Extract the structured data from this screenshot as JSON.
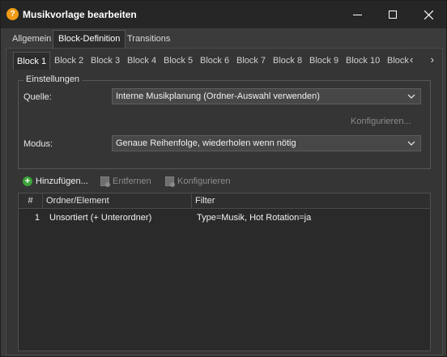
{
  "window": {
    "title": "Musikvorlage bearbeiten",
    "app_icon_glyph": "?",
    "accent_color": "#f29b16"
  },
  "main_tabs": [
    {
      "label": "Allgemein",
      "active": false
    },
    {
      "label": "Block-Definition",
      "active": true
    },
    {
      "label": "Transitions",
      "active": false
    }
  ],
  "block_tabs": [
    {
      "label": "Block 1",
      "active": true
    },
    {
      "label": "Block 2",
      "active": false
    },
    {
      "label": "Block 3",
      "active": false
    },
    {
      "label": "Block 4",
      "active": false
    },
    {
      "label": "Block 5",
      "active": false
    },
    {
      "label": "Block 6",
      "active": false
    },
    {
      "label": "Block 7",
      "active": false
    },
    {
      "label": "Block 8",
      "active": false
    },
    {
      "label": "Block 9",
      "active": false
    },
    {
      "label": "Block 10",
      "active": false
    },
    {
      "label": "Block",
      "active": false
    }
  ],
  "settings": {
    "legend": "Einstellungen",
    "source_label": "Quelle:",
    "source_value": "Interne Musikplanung (Ordner-Auswahl verwenden)",
    "configure_label": "Konfigurieren...",
    "mode_label": "Modus:",
    "mode_value": "Genaue Reihenfolge, wiederholen wenn nötig"
  },
  "toolbar": {
    "add_label": "Hinzufügen...",
    "remove_label": "Entfernen",
    "configure_label": "Konfigurieren"
  },
  "table": {
    "columns": [
      "#",
      "Ordner/Element",
      "Filter"
    ],
    "rows": [
      {
        "num": "1",
        "element": "Unsortiert (+ Unterordner)",
        "filter": "Type=Musik, Hot Rotation=ja"
      }
    ]
  }
}
